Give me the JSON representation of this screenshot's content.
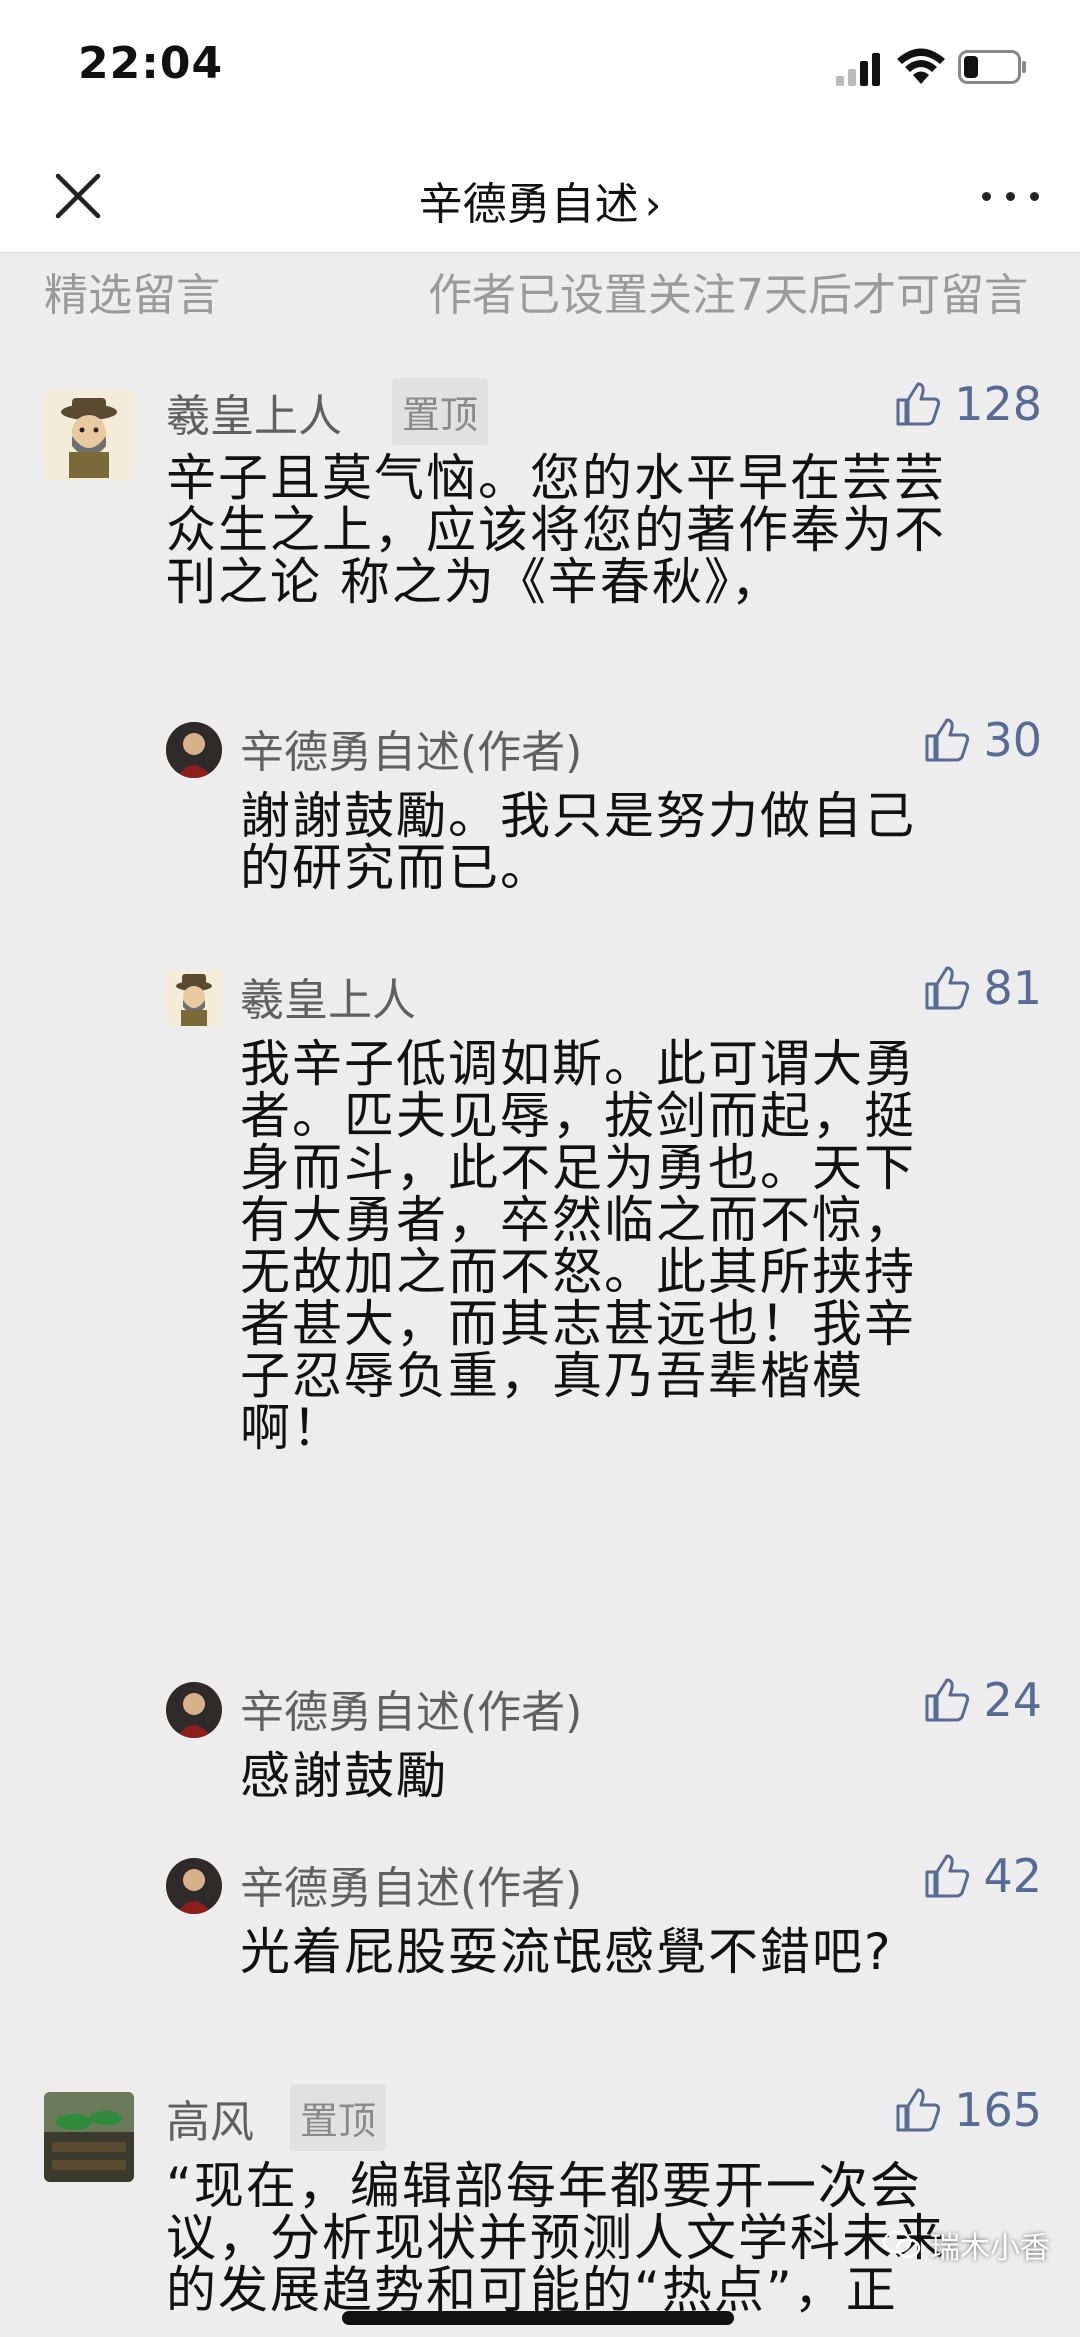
{
  "status_bar": {
    "time": "22:04"
  },
  "nav": {
    "title": "辛德勇自述",
    "chevron": "›"
  },
  "comments_header": {
    "title": "精选留言",
    "note": "作者已设置关注7天后才可留言"
  },
  "comments": [
    {
      "author": "羲皇上人",
      "badge": "置顶",
      "likes": "128",
      "lines": [
        "辛子且莫气恼。您的水平早在芸芸",
        "众生之上，应该将您的著作奉为不",
        "刊之论 称之为《辛春秋》，"
      ],
      "replies": [
        {
          "author": "辛德勇自述(作者)",
          "likes": "30",
          "lines": [
            "謝謝鼓勵。我只是努力做自己",
            "的研究而已。"
          ]
        },
        {
          "author": "羲皇上人",
          "likes": "81",
          "lines": [
            "我辛子低调如斯。此可谓大勇",
            "者。匹夫见辱，拔剑而起，挺",
            "身而斗，此不足为勇也。天下",
            "有大勇者，卒然临之而不惊，",
            "无故加之而不怒。此其所挟持",
            "者甚大，而其志甚远也！我辛",
            "子忍辱负重，真乃吾辈楷模",
            "啊！"
          ]
        },
        {
          "author": "辛德勇自述(作者)",
          "likes": "24",
          "lines": [
            "感謝鼓勵"
          ]
        },
        {
          "author": "辛德勇自述(作者)",
          "likes": "42",
          "lines": [
            "光着屁股耍流氓感覺不錯吧?"
          ]
        }
      ]
    },
    {
      "author": "高风",
      "badge": "置顶",
      "likes": "165",
      "lines": [
        "“现在，编辑部每年都要开一次会",
        "议，分析现状并预测人文学科未来",
        "的发展趋势和可能的“热点”，正"
      ]
    }
  ],
  "watermark": {
    "text": "瑞木小香"
  },
  "colors": {
    "like_blue": "#576b95",
    "background": "#ededed",
    "nickname_gray": "#606060"
  },
  "icons": [
    "close-icon",
    "more-icon",
    "thumbs-up-icon",
    "signal-icon",
    "wifi-icon",
    "battery-icon"
  ]
}
